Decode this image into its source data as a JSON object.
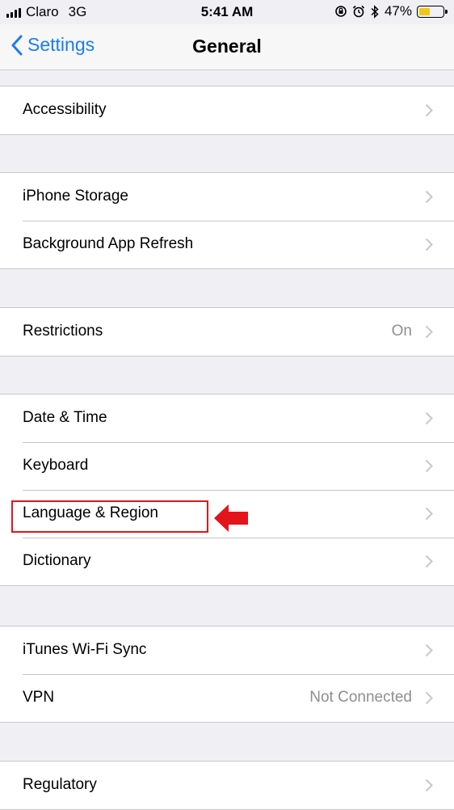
{
  "status": {
    "carrier": "Claro",
    "network": "3G",
    "time": "5:41 AM",
    "battery": "47%",
    "battery_level": 0.47,
    "battery_color": "#f2c51a"
  },
  "nav": {
    "back_label": "Settings",
    "title": "General"
  },
  "groups": [
    {
      "rows": [
        {
          "label": "Accessibility"
        }
      ]
    },
    {
      "rows": [
        {
          "label": "iPhone Storage"
        },
        {
          "label": "Background App Refresh"
        }
      ]
    },
    {
      "rows": [
        {
          "label": "Restrictions",
          "value": "On"
        }
      ]
    },
    {
      "rows": [
        {
          "label": "Date & Time"
        },
        {
          "label": "Keyboard"
        },
        {
          "label": "Language & Region"
        },
        {
          "label": "Dictionary"
        }
      ]
    },
    {
      "rows": [
        {
          "label": "iTunes Wi-Fi Sync"
        },
        {
          "label": "VPN",
          "value": "Not Connected"
        }
      ]
    },
    {
      "rows": [
        {
          "label": "Regulatory"
        }
      ]
    }
  ],
  "colors": {
    "accent": "#1b7cf5",
    "annotation": "#e4141b",
    "background": "#efeff4"
  }
}
